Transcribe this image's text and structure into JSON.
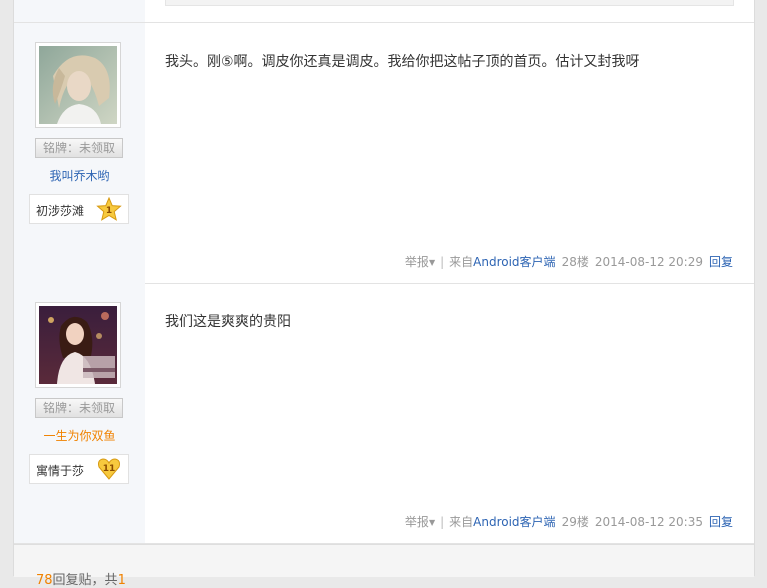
{
  "posts": [
    {
      "medal": "铭牌：未领取",
      "username": "我叫乔木哟",
      "level_name": "初涉莎滩",
      "level_num": "1",
      "content": "我头。刚⑤啊。调皮你还真是调皮。我给你把这帖子顶的首页。估计又封我呀",
      "report": "举报",
      "client_prefix": "来自",
      "client": "Android客户端",
      "floor": "28楼",
      "time": "2014-08-12 20:29",
      "reply": "回复"
    },
    {
      "medal": "铭牌：未领取",
      "username": "一生为你双鱼",
      "level_name": "寓情于莎",
      "level_num": "11",
      "content": "我们这是爽爽的贵阳",
      "report": "举报",
      "client_prefix": "来自",
      "client": "Android客户端",
      "floor": "29楼",
      "time": "2014-08-12 20:35",
      "reply": "回复"
    }
  ],
  "footer": {
    "reply_count": "78",
    "reply_label": "回复贴，共",
    "pages": "1"
  },
  "colors": {
    "link_blue": "#2d64b3",
    "orange": "#f08200",
    "sidebar_bg": "#f5f7fa"
  }
}
